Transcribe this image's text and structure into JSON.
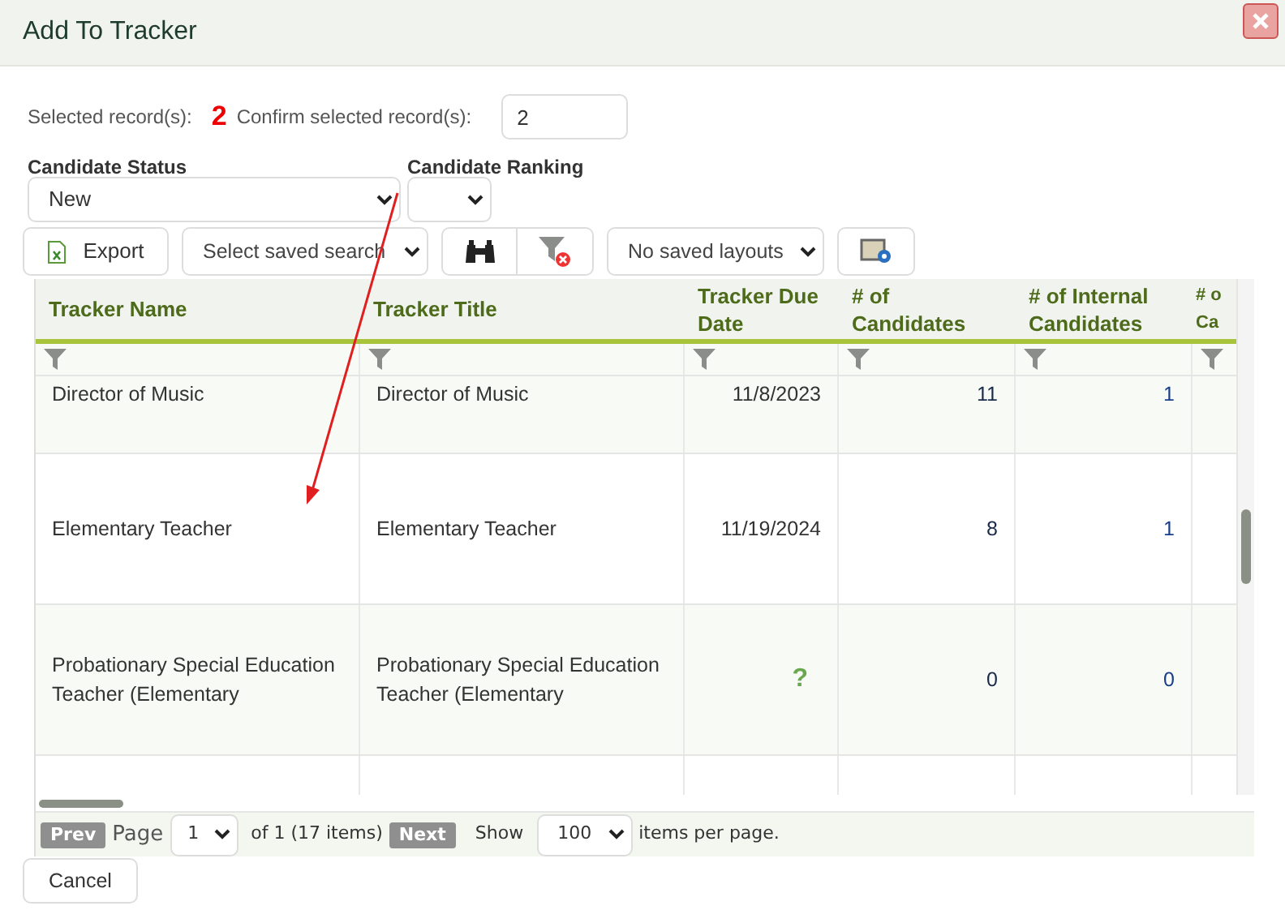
{
  "window": {
    "title": "Add To Tracker"
  },
  "selected_records": {
    "label": "Selected record(s):",
    "count": "2",
    "confirm_label": "Confirm selected record(s):",
    "confirm_value": "2"
  },
  "candidate_status": {
    "label": "Candidate Status",
    "value": "New"
  },
  "candidate_ranking": {
    "label": "Candidate Ranking"
  },
  "toolbar": {
    "export": "Export",
    "saved_search": "Select saved search",
    "layouts": "No saved layouts"
  },
  "table": {
    "columns": [
      "Tracker Name",
      "Tracker Title",
      "Tracker Due Date",
      "# of Candidates",
      "# of Internal Candidates",
      "# o Ca"
    ],
    "rows": [
      {
        "name": "Director of Music",
        "title": "Director of Music",
        "due": "11/8/2023",
        "due_missing": false,
        "candidates": "11",
        "internal": "1"
      },
      {
        "name": "Elementary Teacher",
        "title": "Elementary Teacher",
        "due": "11/19/2024",
        "due_missing": false,
        "candidates": "8",
        "internal": "1"
      },
      {
        "name": "Probationary Special Education Teacher (Elementary",
        "title": "Probationary Special Education Teacher (Elementary",
        "due": "?",
        "due_missing": true,
        "candidates": "0",
        "internal": "0"
      }
    ]
  },
  "pager": {
    "prev": "Prev",
    "page_label": "Page",
    "page": "1",
    "of": "of 1 (17 items)",
    "next": "Next",
    "show": "Show",
    "per_page": "100",
    "per_page_label": "items per page."
  },
  "cancel": "Cancel"
}
